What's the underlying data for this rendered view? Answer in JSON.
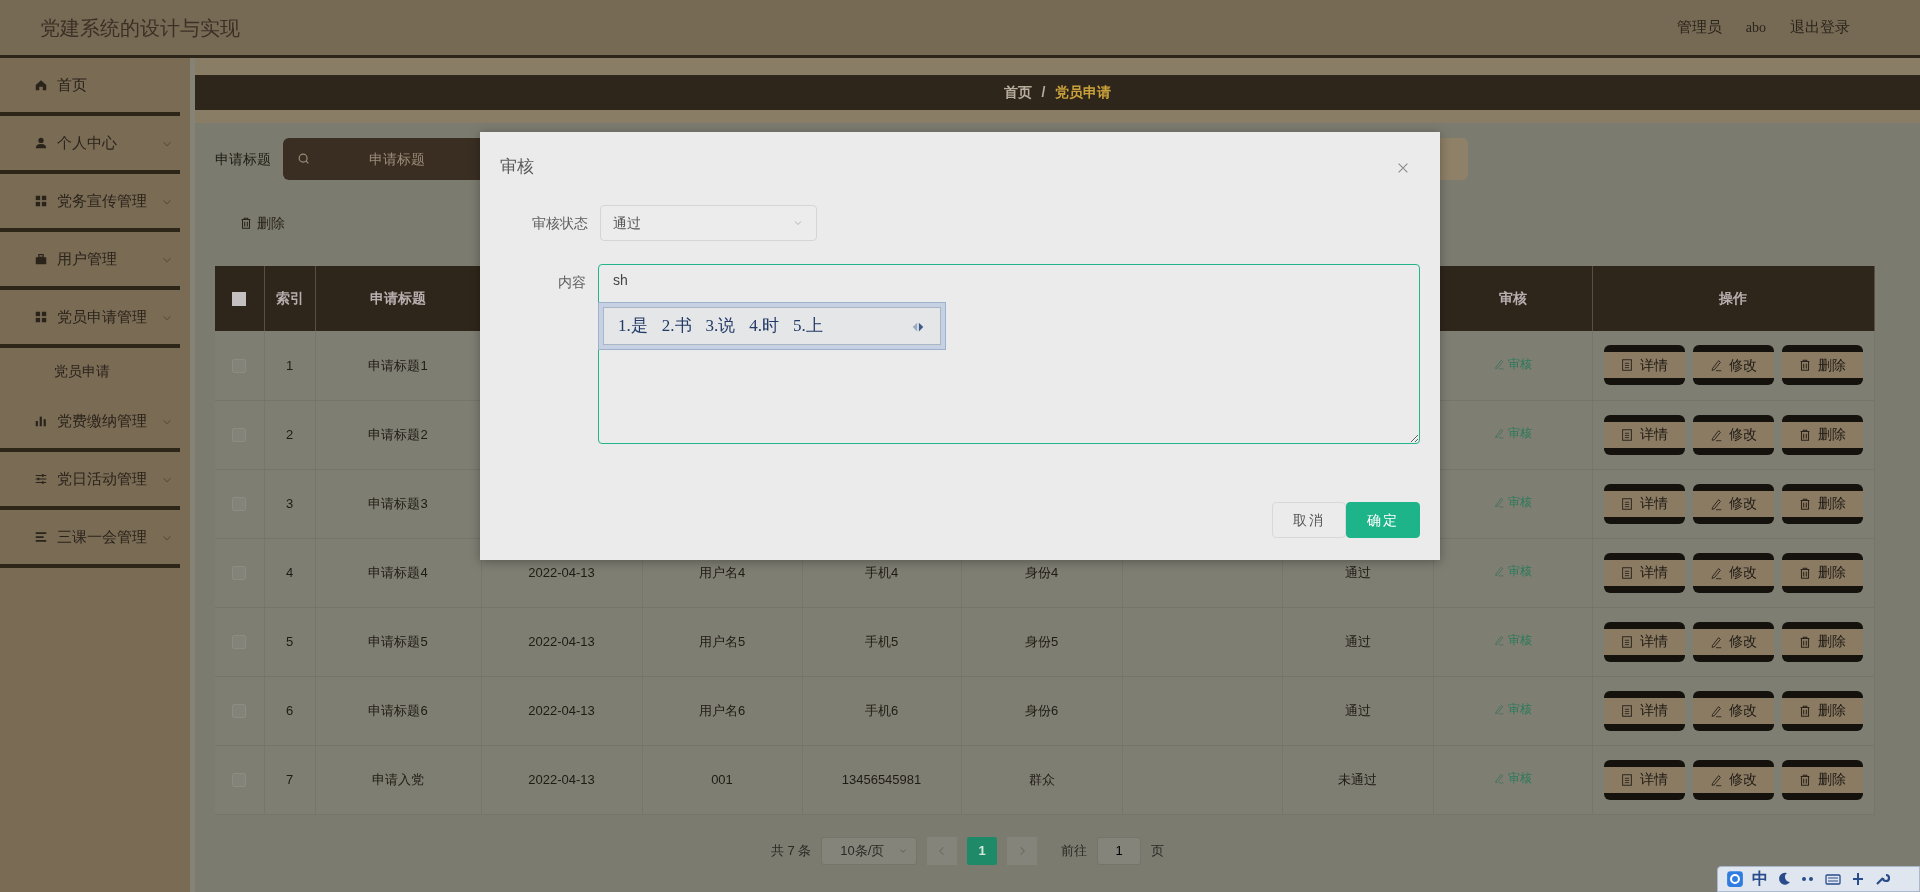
{
  "header": {
    "title": "党建系统的设计与实现",
    "user_role": "管理员",
    "user_name": "abo",
    "logout": "退出登录"
  },
  "sidebar": {
    "items": [
      {
        "label": "首页",
        "expandable": false
      },
      {
        "label": "个人中心",
        "expandable": true,
        "expanded": false
      },
      {
        "label": "党务宣传管理",
        "expandable": true,
        "expanded": false
      },
      {
        "label": "用户管理",
        "expandable": true,
        "expanded": false
      },
      {
        "label": "党员申请管理",
        "expandable": true,
        "expanded": true,
        "children": [
          {
            "label": "党员申请"
          }
        ]
      },
      {
        "label": "党费缴纳管理",
        "expandable": true,
        "expanded": false
      },
      {
        "label": "党日活动管理",
        "expandable": true,
        "expanded": false
      },
      {
        "label": "三课一会管理",
        "expandable": true,
        "expanded": false
      }
    ]
  },
  "breadcrumb": {
    "separator": "/",
    "items": [
      {
        "label": "首页",
        "current": false
      },
      {
        "label": "党员申请",
        "current": true
      }
    ]
  },
  "search": {
    "label": "申请标题",
    "placeholder": "申请标题"
  },
  "toolbar": {
    "delete": "删除"
  },
  "table": {
    "header": {
      "select_all_checked": false,
      "index": "索引",
      "title": "申请标题",
      "review": "审核",
      "actions": "操作"
    },
    "rows": [
      {
        "checked": false,
        "index": "1",
        "title": "申请标题1",
        "review": "审核",
        "actions": [
          "详情",
          "修改",
          "删除"
        ]
      },
      {
        "checked": false,
        "index": "2",
        "title": "申请标题2",
        "review": "审核",
        "actions": [
          "详情",
          "修改",
          "删除"
        ]
      },
      {
        "checked": false,
        "index": "3",
        "title": "申请标题3",
        "review": "审核",
        "actions": [
          "详情",
          "修改",
          "删除"
        ]
      },
      {
        "checked": false,
        "index": "4",
        "title": "申请标题4",
        "date": "2022-04-13",
        "user": "用户名4",
        "phone": "手机4",
        "identity": "身份4",
        "status": "通过",
        "review": "审核",
        "actions": [
          "详情",
          "修改",
          "删除"
        ]
      },
      {
        "checked": false,
        "index": "5",
        "title": "申请标题5",
        "date": "2022-04-13",
        "user": "用户名5",
        "phone": "手机5",
        "identity": "身份5",
        "status": "通过",
        "review": "审核",
        "actions": [
          "详情",
          "修改",
          "删除"
        ]
      },
      {
        "checked": false,
        "index": "6",
        "title": "申请标题6",
        "date": "2022-04-13",
        "user": "用户名6",
        "phone": "手机6",
        "identity": "身份6",
        "status": "通过",
        "review": "审核",
        "actions": [
          "详情",
          "修改",
          "删除"
        ]
      },
      {
        "checked": false,
        "index": "7",
        "title": "申请入党",
        "date": "2022-04-13",
        "user": "001",
        "phone": "13456545981",
        "identity": "群众",
        "status": "未通过",
        "review": "审核",
        "actions": [
          "详情",
          "修改",
          "删除"
        ]
      }
    ]
  },
  "pagination": {
    "total": "共 7 条",
    "page_size": "10条/页",
    "pages": [
      {
        "label": "1",
        "selected": true
      }
    ],
    "goto_label": "前往",
    "goto_value": "1",
    "page_unit": "页"
  },
  "modal": {
    "title": "审核",
    "fields": [
      {
        "kind": "select",
        "label": "审核状态",
        "value": "通过"
      },
      {
        "kind": "textarea",
        "label": "内容",
        "value": "sh"
      }
    ],
    "buttons": [
      {
        "label": "取消",
        "kind": "default"
      },
      {
        "label": "确定",
        "kind": "primary"
      }
    ]
  },
  "ime": {
    "candidates": [
      "1.是",
      "2.书",
      "3.说",
      "4.时",
      "5.上"
    ],
    "mode": "中"
  }
}
